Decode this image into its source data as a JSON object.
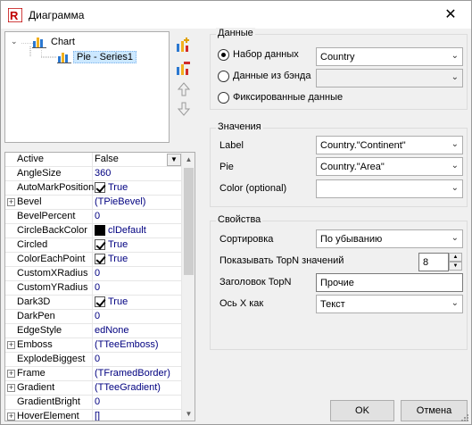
{
  "window": {
    "title": "Диаграмма",
    "close_glyph": "✕"
  },
  "tree": {
    "root_label": "Chart",
    "child_label": "Pie - Series1"
  },
  "inspector": {
    "rows": [
      {
        "name": "Active",
        "value": "False",
        "kind": "text",
        "dropdown": true
      },
      {
        "name": "AngleSize",
        "value": "360",
        "kind": "text"
      },
      {
        "name": "AutoMarkPosition",
        "value": "True",
        "kind": "check"
      },
      {
        "name": "Bevel",
        "value": "(TPieBevel)",
        "kind": "text",
        "plus": true
      },
      {
        "name": "BevelPercent",
        "value": "0",
        "kind": "text"
      },
      {
        "name": "CircleBackColor",
        "value": "clDefault",
        "kind": "color"
      },
      {
        "name": "Circled",
        "value": "True",
        "kind": "check"
      },
      {
        "name": "ColorEachPoint",
        "value": "True",
        "kind": "check"
      },
      {
        "name": "CustomXRadius",
        "value": "0",
        "kind": "text"
      },
      {
        "name": "CustomYRadius",
        "value": "0",
        "kind": "text"
      },
      {
        "name": "Dark3D",
        "value": "True",
        "kind": "check"
      },
      {
        "name": "DarkPen",
        "value": "0",
        "kind": "text"
      },
      {
        "name": "EdgeStyle",
        "value": "edNone",
        "kind": "text"
      },
      {
        "name": "Emboss",
        "value": "(TTeeEmboss)",
        "kind": "text",
        "plus": true
      },
      {
        "name": "ExplodeBiggest",
        "value": "0",
        "kind": "text"
      },
      {
        "name": "Frame",
        "value": "(TFramedBorder)",
        "kind": "text",
        "plus": true
      },
      {
        "name": "Gradient",
        "value": "(TTeeGradient)",
        "kind": "text",
        "plus": true
      },
      {
        "name": "GradientBright",
        "value": "0",
        "kind": "text"
      },
      {
        "name": "HoverElement",
        "value": "[]",
        "kind": "text",
        "plus": true
      }
    ]
  },
  "data_group": {
    "title": "Данные",
    "dataset_label": "Набор данных",
    "dataset_value": "Country",
    "band_label": "Данные из бэнда",
    "band_value": "",
    "fixed_label": "Фиксированные данные"
  },
  "values_group": {
    "title": "Значения",
    "label_label": "Label",
    "label_value": "Country.\"Continent\"",
    "pie_label": "Pie",
    "pie_value": "Country.\"Area\"",
    "color_label": "Color (optional)",
    "color_value": ""
  },
  "props_group": {
    "title": "Свойства",
    "sort_label": "Сортировка",
    "sort_value": "По убыванию",
    "topn_label": "Показывать TopN значений",
    "topn_value": "8",
    "topn_caption_label": "Заголовок TopN",
    "topn_caption_value": "Прочие",
    "xaxis_label": "Ось X как",
    "xaxis_value": "Текст"
  },
  "buttons": {
    "ok": "OK",
    "cancel": "Отмена"
  }
}
